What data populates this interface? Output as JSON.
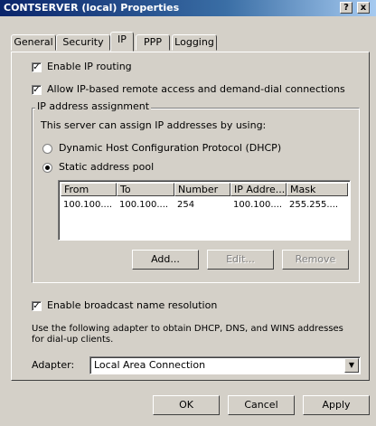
{
  "window": {
    "title": "CONTSERVER (local) Properties",
    "help_glyph": "?",
    "close_glyph": "x"
  },
  "tabs": [
    {
      "label": "General"
    },
    {
      "label": "Security"
    },
    {
      "label": "IP"
    },
    {
      "label": "PPP"
    },
    {
      "label": "Logging"
    }
  ],
  "active_tab": "IP",
  "options": {
    "enable_ip_routing": {
      "label": "Enable IP routing",
      "checked": true
    },
    "allow_ip_remote": {
      "label": "Allow IP-based remote access and demand-dial connections",
      "checked": true
    }
  },
  "ip_assignment": {
    "group_label": "IP address assignment",
    "description": "This server can assign IP addresses by using:",
    "dhcp": {
      "label": "Dynamic Host Configuration Protocol (DHCP)",
      "selected": false
    },
    "static": {
      "label": "Static address pool",
      "selected": true
    },
    "columns": [
      "From",
      "To",
      "Number",
      "IP Addre...",
      "Mask"
    ],
    "rows": [
      [
        "100.100....",
        "100.100....",
        "254",
        "100.100....",
        "255.255...."
      ]
    ],
    "add_label": "Add...",
    "edit_label": "Edit...",
    "remove_label": "Remove"
  },
  "broadcast": {
    "label": "Enable broadcast name resolution",
    "checked": true
  },
  "adapter_note": "Use the following adapter to obtain DHCP, DNS, and WINS addresses for dial-up clients.",
  "adapter": {
    "label": "Adapter:",
    "value": "Local Area Connection"
  },
  "footer": {
    "ok": "OK",
    "cancel": "Cancel",
    "apply": "Apply"
  },
  "check_glyph": "✓"
}
